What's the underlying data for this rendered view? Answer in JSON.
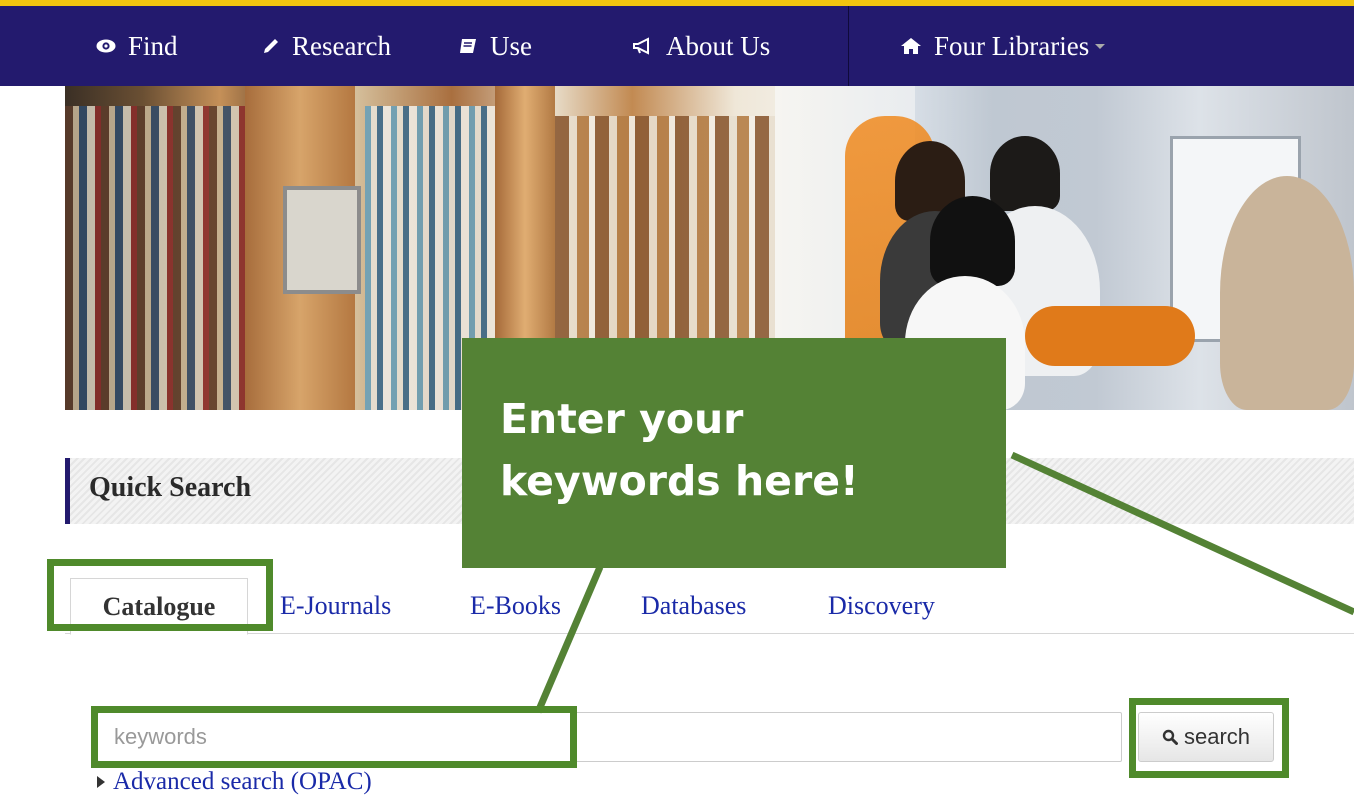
{
  "nav": {
    "items": [
      {
        "label": "Find",
        "icon": "eye-icon"
      },
      {
        "label": "Research",
        "icon": "pencil-icon"
      },
      {
        "label": "Use",
        "icon": "book-icon"
      },
      {
        "label": "About Us",
        "icon": "megaphone-icon"
      }
    ],
    "libraries": {
      "label": "Four Libraries",
      "icon": "home-icon"
    }
  },
  "hero": {
    "image": "library-banner-photo"
  },
  "quick_search": {
    "title": "Quick Search",
    "tabs": [
      "Catalogue",
      "E-Journals",
      "E-Books",
      "Databases",
      "Discovery"
    ],
    "active_tab": "Catalogue",
    "input": {
      "placeholder": "keywords",
      "value": ""
    },
    "search_button": "search",
    "advanced_link": "Advanced search (OPAC)"
  },
  "annotation": {
    "callout_line1": "Enter your",
    "callout_line2": "keywords here!",
    "highlight_color": "#4f8a2b",
    "callout_color": "#548235"
  },
  "colors": {
    "navbar": "#231a6e",
    "accent_top": "#f2c40f",
    "link": "#1a2aa8"
  }
}
